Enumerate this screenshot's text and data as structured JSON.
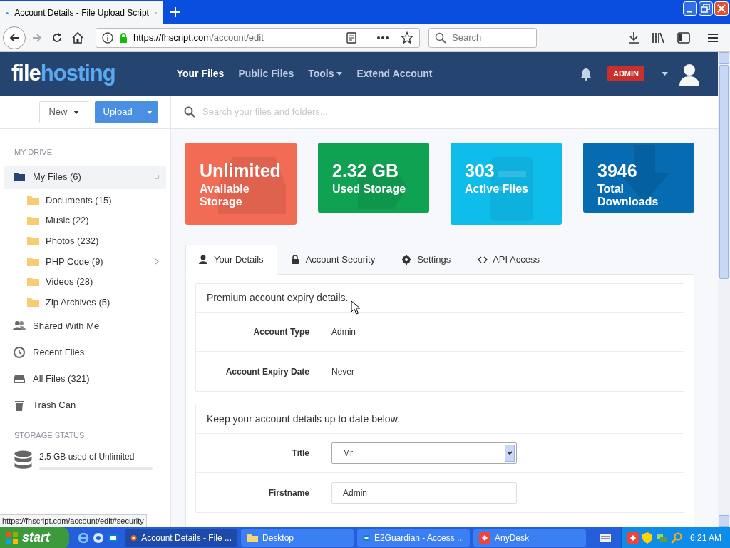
{
  "browser": {
    "tab_title": "Account Details - File Upload Script",
    "url_host": "https://fhscript.com",
    "url_path": "/account/edit",
    "search_placeholder": "Search"
  },
  "header": {
    "logo": [
      "file",
      "hosting"
    ],
    "nav": [
      {
        "label": "Your Files",
        "selected": true,
        "dropdown": false
      },
      {
        "label": "Public Files",
        "selected": false,
        "dropdown": false
      },
      {
        "label": "Tools",
        "selected": false,
        "dropdown": true
      },
      {
        "label": "Extend Account",
        "selected": false,
        "dropdown": false
      }
    ],
    "badge": "ADMIN"
  },
  "sidebar": {
    "new_button": "New",
    "upload_button": "Upload",
    "drive_heading": "MY DRIVE",
    "items": [
      {
        "kind": "root",
        "label": "My Files (6)",
        "selected": true,
        "children": [
          {
            "label": "Documents (15)",
            "expandable": false
          },
          {
            "label": "Music (22)",
            "expandable": false
          },
          {
            "label": "Photos (232)",
            "expandable": false
          },
          {
            "label": "PHP Code (9)",
            "expandable": true
          },
          {
            "label": "Videos (28)",
            "expandable": false
          },
          {
            "label": "Zip Archives (5)",
            "expandable": false
          }
        ]
      },
      {
        "kind": "shared",
        "label": "Shared With Me",
        "selected": false
      },
      {
        "kind": "recent",
        "label": "Recent Files",
        "selected": false
      },
      {
        "kind": "all",
        "label": "All Files (321)",
        "selected": false
      },
      {
        "kind": "trash",
        "label": "Trash Can",
        "selected": false
      }
    ],
    "storage_heading": "STORAGE STATUS",
    "storage_text": "2.5 GB used of Unlimited"
  },
  "search_placeholder": "Search your files and folders...",
  "stats": [
    {
      "value": "Unlimited",
      "label": "Available Storage",
      "color": "#f26b55"
    },
    {
      "value": "2.32 GB",
      "label": "Used Storage",
      "color": "#10a253"
    },
    {
      "value": "303",
      "label": "Active Files",
      "color": "#0fbdeb"
    },
    {
      "value": "3946",
      "label": "Total Downloads",
      "color": "#066bb1"
    }
  ],
  "tabs": [
    {
      "kind": "user",
      "label": "Your Details",
      "selected": true
    },
    {
      "kind": "lock",
      "label": "Account Security",
      "selected": false
    },
    {
      "kind": "gear",
      "label": "Settings",
      "selected": false
    },
    {
      "kind": "code",
      "label": "API Access",
      "selected": false
    }
  ],
  "expiry_panel": {
    "heading": "Premium account expiry details.",
    "rows": [
      {
        "label": "Account Type",
        "value": "Admin"
      },
      {
        "label": "Account Expiry Date",
        "value": "Never"
      }
    ]
  },
  "details_panel": {
    "heading": "Keep your account details up to date below.",
    "fields": [
      {
        "kind": "select",
        "label": "Title",
        "value": "Mr"
      },
      {
        "kind": "text",
        "label": "Firstname",
        "value": "Admin"
      }
    ]
  },
  "status_url": "https://fhscript.com/account/edit#security",
  "taskbar": {
    "start": "start",
    "windows": [
      {
        "kind": "firefox",
        "label": "Account Details - File ...",
        "selected": true
      },
      {
        "kind": "folder",
        "label": "Desktop",
        "selected": false
      },
      {
        "kind": "remote",
        "label": "E2Guardian - Access ...",
        "selected": false
      },
      {
        "kind": "anydesk",
        "label": "AnyDesk",
        "selected": false
      }
    ],
    "clock": "6:21 AM"
  }
}
